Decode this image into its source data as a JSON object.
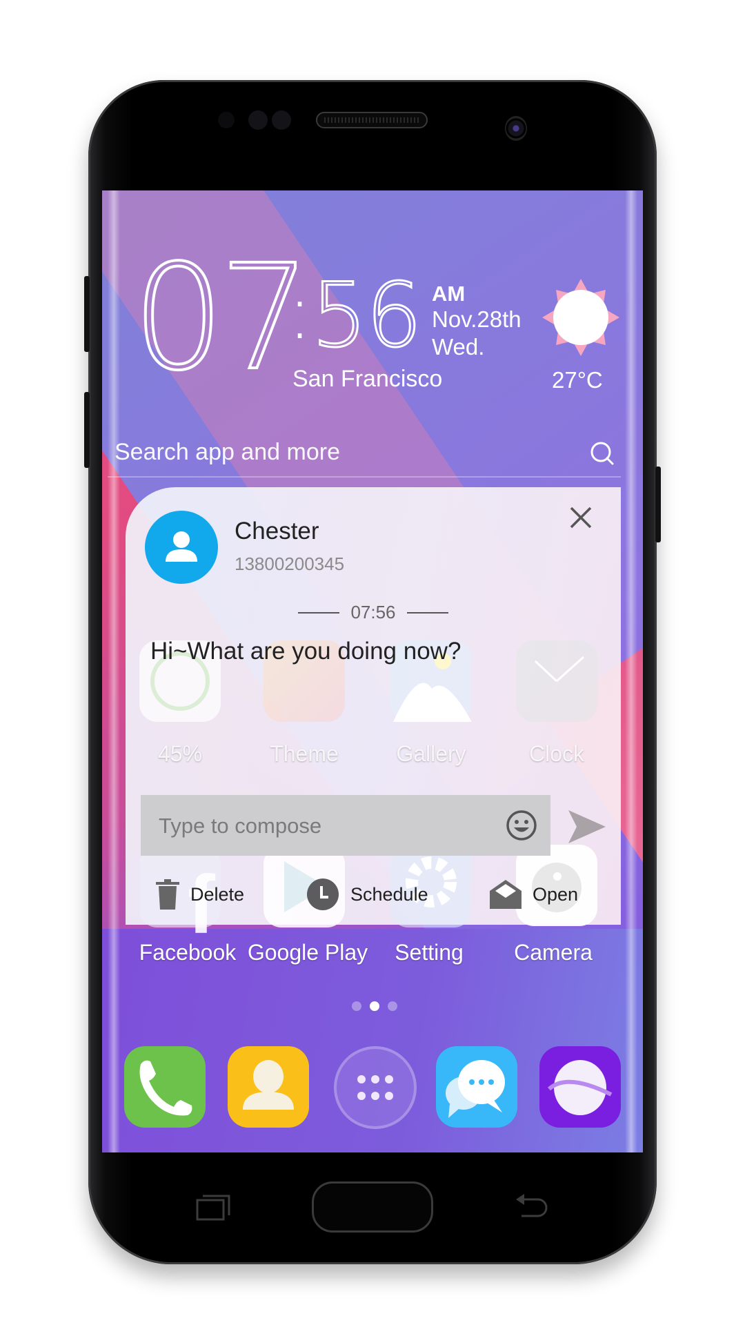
{
  "clock": {
    "hours": "07",
    "minutes": "56",
    "ampm": "AM",
    "date": "Nov.28th",
    "weekday": "Wed.",
    "city": "San Francisco"
  },
  "weather": {
    "icon": "sun-icon",
    "temperature": "27°C"
  },
  "search": {
    "placeholder": "Search app and more",
    "icon": "search-icon"
  },
  "home_apps_row1": [
    {
      "label": "45%",
      "icon": "battery-ring-icon"
    },
    {
      "label": "Theme",
      "icon": "theme-flower-icon"
    },
    {
      "label": "Gallery",
      "icon": "gallery-mountain-icon"
    },
    {
      "label": "Clock",
      "icon": "clock-icon"
    }
  ],
  "home_apps_row2": [
    {
      "label": "Facebook",
      "icon": "facebook-icon"
    },
    {
      "label": "Google Play",
      "icon": "google-play-icon"
    },
    {
      "label": "Setting",
      "icon": "gear-icon"
    },
    {
      "label": "Camera",
      "icon": "camera-icon"
    }
  ],
  "notification": {
    "contact_name": "Chester",
    "contact_number": "13800200345",
    "time": "07:56",
    "message": "Hi~What are you doing now?",
    "compose_placeholder": "Type to compose",
    "actions": [
      {
        "label": "Delete",
        "icon": "trash-icon"
      },
      {
        "label": "Schedule",
        "icon": "clock-icon"
      },
      {
        "label": "Open",
        "icon": "envelope-open-icon"
      }
    ],
    "accent": "#11a8ec"
  },
  "pager": {
    "pages": 3,
    "current": 2
  },
  "dock": [
    {
      "name": "phone",
      "icon": "phone-icon",
      "color": "#6cc24a"
    },
    {
      "name": "contacts",
      "icon": "contacts-icon",
      "color": "#fbbf1a"
    },
    {
      "name": "app-drawer",
      "icon": "app-drawer-icon"
    },
    {
      "name": "messages",
      "icon": "messages-icon",
      "color": "#38b8f8"
    },
    {
      "name": "browser",
      "icon": "browser-icon",
      "color": "#7a1ee0"
    }
  ]
}
